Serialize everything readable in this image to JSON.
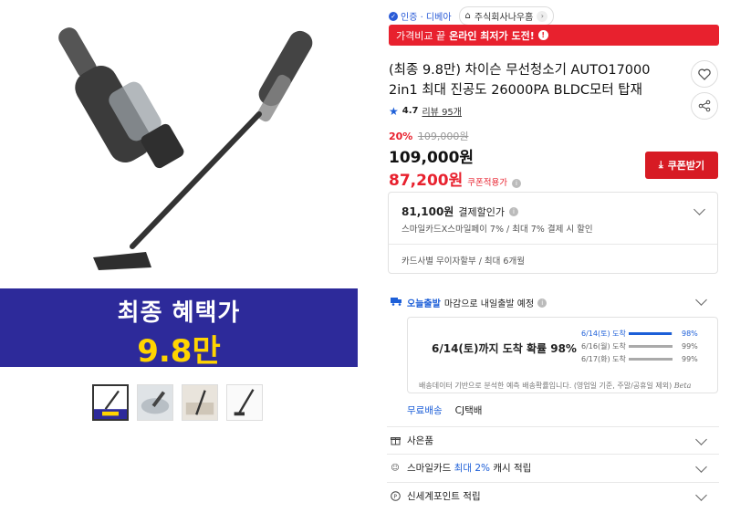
{
  "gallery": {
    "banner_line1": "최종 혜택가",
    "banner_line2": "9.8만",
    "thumbnails": [
      "vacuum-main",
      "vacuum-hand-use",
      "vacuum-room",
      "vacuum-stick"
    ]
  },
  "seller": {
    "certification": "인증 · 디베아",
    "store_name": "주식회사나우홈"
  },
  "alert": {
    "prefix": "가격비교 끝",
    "highlight": "온라인 최저가 도전!"
  },
  "product": {
    "title": "(최종 9.8만) 차이슨 무선청소기 AUTO17000 2in1 최대 진공도 26000PA BLDC모터 탑재",
    "rating": "4.7",
    "review_count": "리뷰 95개"
  },
  "price": {
    "discount_pct": "20%",
    "original": "109,000원",
    "sale": "109,000원",
    "coupon_price": "87,200원",
    "coupon_note": "쿠폰적용가",
    "coupon_button": "쿠폰받기"
  },
  "card_benefit": {
    "amount": "81,100원",
    "label": "결제할인가",
    "detail": "스마일카드X스마일페이 7% / 최대 7% 결제 시 할인",
    "installment": "카드사별 무이자할부 / 최대 6개월"
  },
  "shipping": {
    "badge": "오늘출발",
    "headline": "마감으로 내일출발 예정",
    "probability_main": "6/14(토)까지 도착 확률 98%",
    "rows": [
      {
        "label": "6/14(토) 도착",
        "pct": "98%",
        "value": 0.98
      },
      {
        "label": "6/16(월) 도착",
        "pct": "99%",
        "value": 0.99
      },
      {
        "label": "6/17(화) 도착",
        "pct": "99%",
        "value": 0.99
      }
    ],
    "note": "배송데이터 기반으로 분석한 예측 배송확률입니다. (영업일 기준, 주말/공휴일 제외)",
    "beta": "Beta",
    "free_shipping": "무료배송",
    "carrier": "CJ택배"
  },
  "options": {
    "gift": "사은품",
    "smile_card_prefix": "스마일카드",
    "smile_card_accent": "최대 2%",
    "smile_card_suffix": "캐시 적립",
    "shinsegae": "신세계포인트 적립"
  },
  "colors": {
    "accent_blue": "#1d5fd8",
    "alert_red": "#e8212e",
    "banner_navy": "#2d2a9a",
    "banner_yellow": "#ffd400"
  }
}
